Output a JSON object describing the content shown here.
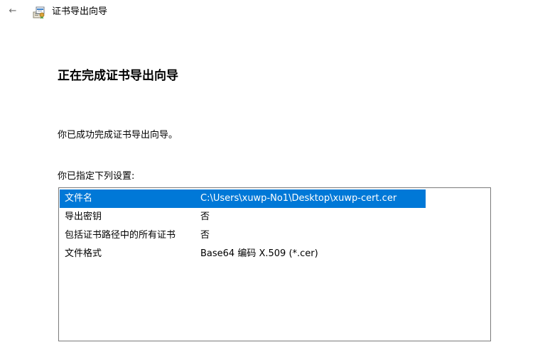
{
  "window": {
    "back_glyph": "←",
    "title": "证书导出向导",
    "icon": "certificate-wizard-icon"
  },
  "main": {
    "heading": "正在完成证书导出向导",
    "success_message": "你已成功完成证书导出向导。",
    "settings_label": "你已指定下列设置:"
  },
  "settings": {
    "rows": [
      {
        "key": "文件名",
        "value": "C:\\Users\\xuwp-No1\\Desktop\\xuwp-cert.cer",
        "selected": true
      },
      {
        "key": "导出密钥",
        "value": "否",
        "selected": false
      },
      {
        "key": "包括证书路径中的所有证书",
        "value": "否",
        "selected": false
      },
      {
        "key": "文件格式",
        "value": "Base64 编码 X.509 (*.cer)",
        "selected": false
      }
    ]
  },
  "colors": {
    "selection": "#0078d7",
    "border": "#7a7a7a",
    "text": "#000000"
  }
}
